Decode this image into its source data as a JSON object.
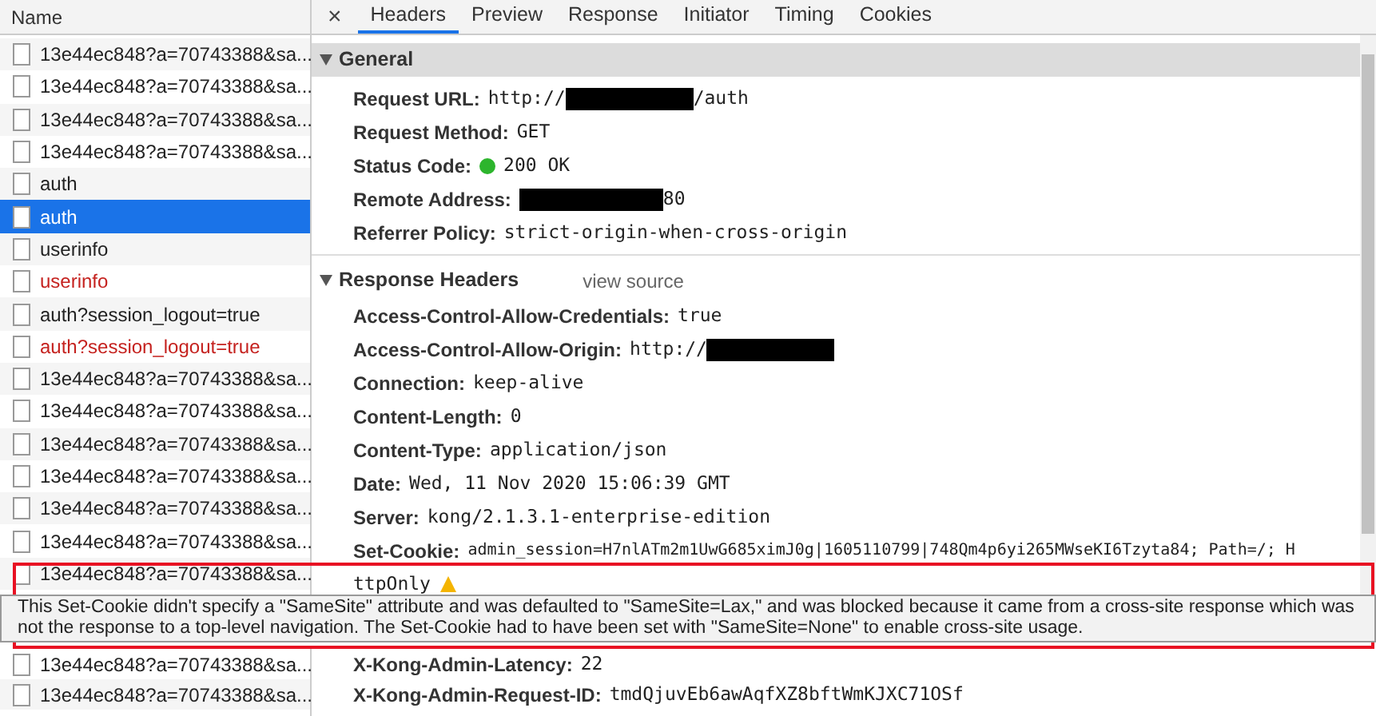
{
  "request_list": {
    "header": "Name",
    "rows_above": [
      {
        "name": "13e44ec848?a=70743388&sa...",
        "selected": false
      },
      {
        "name": "13e44ec848?a=70743388&sa...",
        "selected": false
      },
      {
        "name": "13e44ec848?a=70743388&sa...",
        "selected": false
      },
      {
        "name": "13e44ec848?a=70743388&sa...",
        "selected": false
      },
      {
        "name": "auth",
        "selected": false
      },
      {
        "name": "auth",
        "selected": true
      },
      {
        "name": "userinfo",
        "selected": false
      },
      {
        "name": "userinfo",
        "failed": true,
        "selected": false
      },
      {
        "name": "auth?session_logout=true",
        "selected": false
      },
      {
        "name": "auth?session_logout=true",
        "failed": true,
        "selected": false
      },
      {
        "name": "13e44ec848?a=70743388&sa...",
        "selected": false
      },
      {
        "name": "13e44ec848?a=70743388&sa...",
        "selected": false
      },
      {
        "name": "13e44ec848?a=70743388&sa...",
        "selected": false
      },
      {
        "name": "13e44ec848?a=70743388&sa...",
        "selected": false
      },
      {
        "name": "13e44ec848?a=70743388&sa...",
        "selected": false
      },
      {
        "name": "13e44ec848?a=70743388&sa...",
        "selected": false
      },
      {
        "name": "13e44ec848?a=70743388&sa...",
        "selected": false
      }
    ],
    "rows_below": [
      {
        "name": "13e44ec848?a=70743388&sa...",
        "selected": false
      },
      {
        "name": "13e44ec848?a=70743388&sa...",
        "selected": false
      }
    ]
  },
  "close_symbol": "×",
  "tabs": [
    {
      "label": "Headers",
      "selected": true
    },
    {
      "label": "Preview",
      "selected": false
    },
    {
      "label": "Response",
      "selected": false
    },
    {
      "label": "Initiator",
      "selected": false
    },
    {
      "label": "Timing",
      "selected": false
    },
    {
      "label": "Cookies",
      "selected": false
    }
  ],
  "general": {
    "title": "General",
    "expanded": true,
    "rows": [
      {
        "label": "Request URL:",
        "prefix": "http://",
        "redacted": true,
        "value": "/auth"
      },
      {
        "label": "Request Method:",
        "value": "GET"
      },
      {
        "label": "Status Code:",
        "value": "200 OK",
        "status_dot": true
      },
      {
        "label": "Remote Address:",
        "redacted": true,
        "value": "80"
      },
      {
        "label": "Referrer Policy:",
        "value": "strict-origin-when-cross-origin"
      }
    ]
  },
  "response_headers": {
    "title": "Response Headers",
    "link": "view source",
    "expanded": true,
    "rows_above": [
      {
        "label": "Access-Control-Allow-Credentials:",
        "value": "true"
      },
      {
        "label": "Access-Control-Allow-Origin:",
        "prefix": "http://",
        "redacted": true
      },
      {
        "label": "Connection:",
        "value": "keep-alive"
      },
      {
        "label": "Content-Length:",
        "value": "0"
      },
      {
        "label": "Content-Type:",
        "value": "application/json"
      },
      {
        "label": "Date:",
        "value": "Wed, 11 Nov 2020 15:06:39 GMT"
      },
      {
        "label": "Server:",
        "value": "kong/2.1.3.1-enterprise-edition"
      },
      {
        "label": "Set-Cookie:",
        "value": "admin_session=H7nlATm2m1UwG685ximJ0g|1605110799|748Qm4p6yi265MWseKI6Tzyta84; Path=/; H"
      }
    ],
    "cookie_continuation": "ttpOnly",
    "cookie_warning": true,
    "rows_below": [
      {
        "label": "X-Kong-Admin-Latency:",
        "value": "22"
      },
      {
        "label": "X-Kong-Admin-Request-ID:",
        "value": "tmdQjuvEb6awAqfXZ8bftWmKJXC71OSf"
      }
    ]
  },
  "tooltip": {
    "text": "This Set-Cookie didn't specify a \"SameSite\" attribute and was defaulted to \"SameSite=Lax,\" and was blocked because it came from a cross-site response which was not the response to a top-level navigation. The Set-Cookie had to have been set with \"SameSite=None\" to enable cross-site usage."
  }
}
